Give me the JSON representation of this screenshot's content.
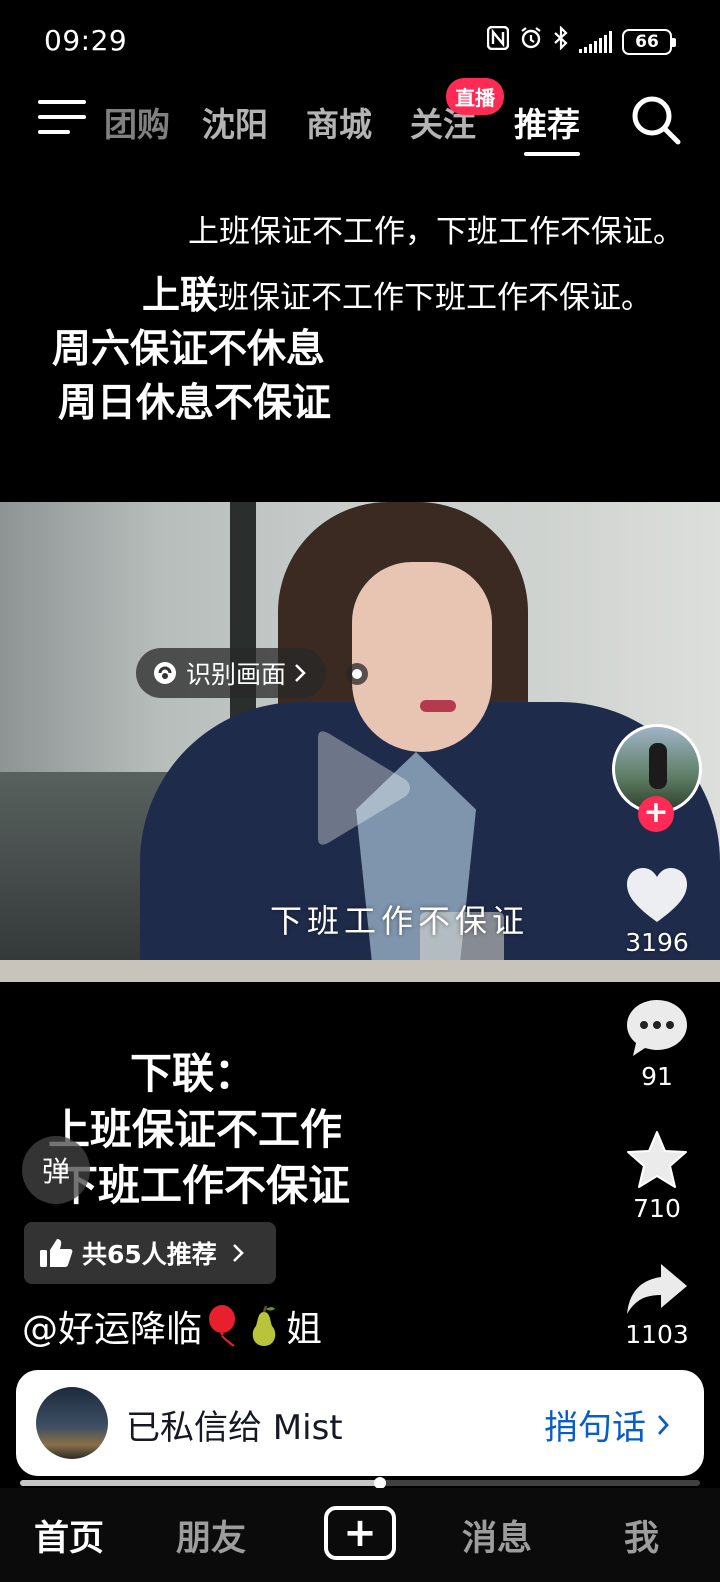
{
  "status_bar": {
    "time": "09:29",
    "battery": "66",
    "icons": [
      "nfc-icon",
      "alarm-icon",
      "bluetooth-icon",
      "signal-icon",
      "battery-icon"
    ]
  },
  "top_nav": {
    "tabs": [
      {
        "label": "团购"
      },
      {
        "label": "沈阳"
      },
      {
        "label": "商城"
      },
      {
        "label": "关注"
      },
      {
        "label": "推荐"
      }
    ],
    "active_tab": "推荐",
    "live_badge": "直播"
  },
  "video": {
    "caption_line1": "上班保证不工作，下班工作不保证。",
    "caption_line2_prefix": "上联",
    "caption_line2_rest": "班保证不工作下班工作不保证。",
    "caption_line3": "周六保证不休息",
    "caption_line4": "周日休息不保证",
    "recognize_chip": "识别画面",
    "subtitle": "下班工作不保证",
    "lower_caption1": "下联：",
    "lower_caption2": "上班保证不工作",
    "lower_caption3": "下班工作不保证"
  },
  "actions": {
    "likes": "3196",
    "comments": "91",
    "favorites": "710",
    "shares": "1103"
  },
  "meta": {
    "danmaku_label": "弹",
    "recommend": "共65人推荐",
    "author_prefix": "@好运降临",
    "author_suffix": "姐"
  },
  "dm_toast": {
    "text": "已私信给 Mist",
    "action": "捎句话"
  },
  "playback": {
    "progress_fraction": 0.53
  },
  "bottom_nav": {
    "home": "首页",
    "friends": "朋友",
    "messages": "消息",
    "me": "我"
  },
  "colors": {
    "accent_red": "#fe2c55",
    "link_blue": "#0a5cc7"
  }
}
